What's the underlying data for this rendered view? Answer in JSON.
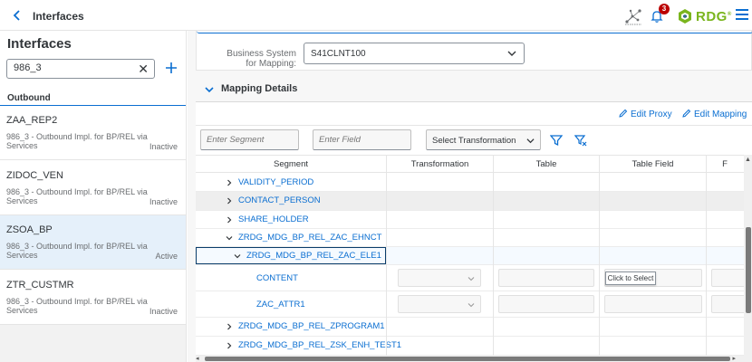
{
  "shell": {
    "back_icon": "chevron-left-icon",
    "title": "Interfaces",
    "notification_count": "3",
    "logo_text": "RDG",
    "logo_tm": "®",
    "colors": {
      "brand_blue": "#0a6ed1",
      "logo_green": "#7ab51d",
      "badge_red": "#bb0000"
    }
  },
  "master": {
    "title": "Interfaces",
    "search": {
      "value": "986_3"
    },
    "section_label": "Outbound",
    "items": [
      {
        "name": "ZAA_REP2",
        "description": "986_3 - Outbound Impl. for BP/REL via Services",
        "status": "Inactive"
      },
      {
        "name": "ZIDOC_VEN",
        "description": "986_3 - Outbound Impl. for BP/REL via Services",
        "status": "Inactive"
      },
      {
        "name": "ZSOA_BP",
        "description": "986_3 - Outbound Impl. for BP/REL via Services",
        "status": "Active"
      },
      {
        "name": "ZTR_CUSTMR",
        "description": "986_3 - Outbound Impl. for BP/REL via Services",
        "status": "Inactive"
      }
    ]
  },
  "detail": {
    "business_system_label": "Business System for Mapping:",
    "business_system_value": "S41CLNT100",
    "mapping_title": "Mapping Details",
    "edit_proxy": "Edit Proxy",
    "edit_mapping": "Edit Mapping",
    "filters": {
      "segment_placeholder": "Enter Segment",
      "field_placeholder": "Enter Field",
      "transformation_value": "Select Transformation"
    },
    "columns": [
      "Segment",
      "Transformation",
      "Table",
      "Table Field",
      "F"
    ],
    "rows": [
      {
        "label": "VALIDITY_PERIOD",
        "expander": "collapsed"
      },
      {
        "label": "CONTACT_PERSON",
        "expander": "collapsed"
      },
      {
        "label": "SHARE_HOLDER",
        "expander": "collapsed"
      },
      {
        "label": "ZRDG_MDG_BP_REL_ZAC_EHNCT",
        "expander": "expanded"
      },
      {
        "label": "ZRDG_MDG_BP_REL_ZAC_ELE1",
        "expander": "expanded"
      },
      {
        "label": "CONTENT",
        "expander": "none"
      },
      {
        "label": "ZAC_ATTR1",
        "expander": "none"
      },
      {
        "label": "ZRDG_MDG_BP_REL_ZPROGRAM1",
        "expander": "collapsed"
      },
      {
        "label": "ZRDG_MDG_BP_REL_ZSK_ENH_TEST1",
        "expander": "collapsed"
      }
    ],
    "tooltip": "Click to Select"
  }
}
